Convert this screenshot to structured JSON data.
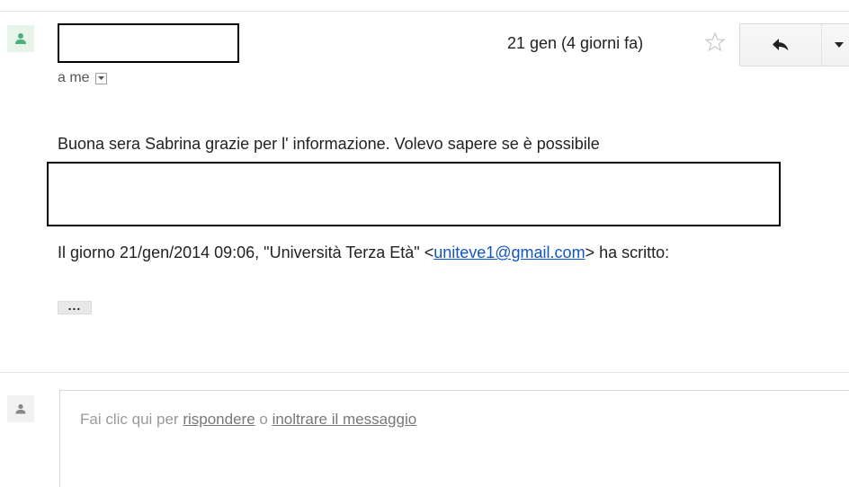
{
  "message": {
    "sender_name": "",
    "date": "21 gen (4 giorni fa)",
    "recipient_label": "a me",
    "body_first_line": "Buona sera Sabrina grazie per l' informazione.  Volevo sapere se è possibile",
    "quote_prefix": "Il giorno 21/gen/2014 09:06, \"Università Terza Età\" <",
    "quote_email": "uniteve1@gmail.com",
    "quote_suffix": "> ha scritto:",
    "trimmed_content_label": "..."
  },
  "reply_box": {
    "prefix": "Fai clic qui per ",
    "reply_link": "rispondere",
    "middle": " o ",
    "forward_link": "inoltrare il messaggio"
  },
  "icons": {
    "sender_avatar": "person-icon",
    "star": "star-icon",
    "reply": "reply-arrow-icon",
    "more": "caret-down-icon",
    "details": "caret-down-icon",
    "reply_avatar": "person-icon"
  },
  "colors": {
    "avatar_green": "#4caf79",
    "link_blue": "#1155cc",
    "placeholder_gray": "#999999"
  }
}
